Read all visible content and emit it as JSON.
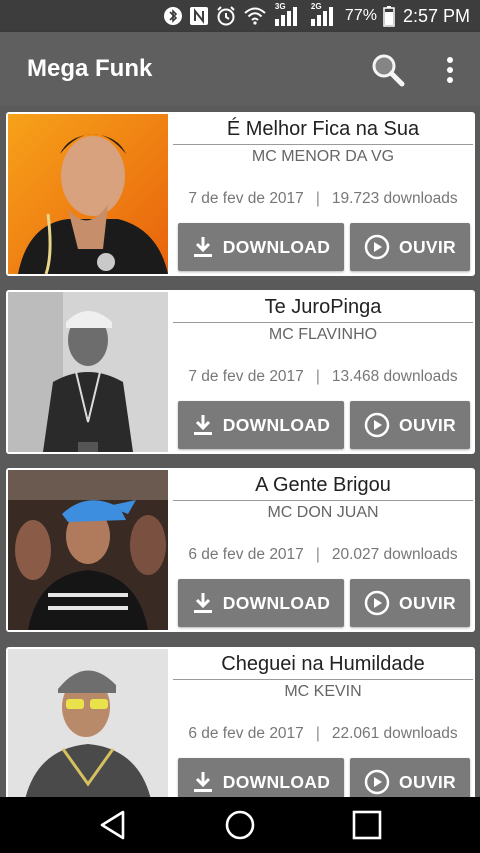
{
  "status_bar": {
    "battery_percent": "77%",
    "time": "2:57 PM",
    "icons": [
      "bluetooth-icon",
      "nfc-icon",
      "alarm-icon",
      "wifi-icon",
      "signal-3g-icon",
      "signal-2g-icon",
      "battery-icon"
    ],
    "net_labels": [
      "3G",
      "2G"
    ]
  },
  "app_bar": {
    "title": "Mega Funk",
    "icons": [
      "search-icon",
      "more-vert-icon"
    ]
  },
  "songs": [
    {
      "title": "É Melhor Fica na Sua",
      "artist": "MC MENOR DA VG",
      "date": "7 de fev de 2017",
      "downloads": "19.723 downloads",
      "download_label": "DOWNLOAD",
      "play_label": "OUVIR"
    },
    {
      "title": "Te JuroPinga",
      "artist": "MC FLAVINHO",
      "date": "7 de fev de 2017",
      "downloads": "13.468 downloads",
      "download_label": "DOWNLOAD",
      "play_label": "OUVIR"
    },
    {
      "title": "A Gente Brigou",
      "artist": "MC DON JUAN",
      "date": "6 de fev de 2017",
      "downloads": "20.027 downloads",
      "download_label": "DOWNLOAD",
      "play_label": "OUVIR"
    },
    {
      "title": "Cheguei na Humildade",
      "artist": "MC KEVIN",
      "date": "6 de fev de 2017",
      "downloads": "22.061 downloads",
      "download_label": "DOWNLOAD",
      "play_label": "OUVIR"
    }
  ],
  "meta_separator": "|",
  "nav_bar": {
    "icons": [
      "back-icon",
      "home-icon",
      "recents-icon"
    ]
  },
  "colors": {
    "status_bar": "#3d3d3d",
    "app_bar": "#5f5f5f",
    "background": "#5a5a5a",
    "button": "#7a7a7a"
  }
}
